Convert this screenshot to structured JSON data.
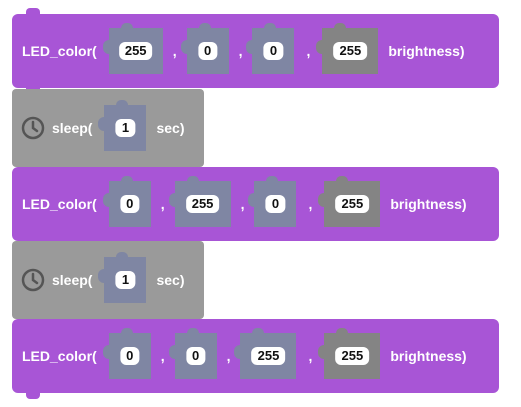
{
  "blocks": [
    {
      "type": "led",
      "label": "LED_color(",
      "values": [
        "255",
        "0",
        "0",
        "255"
      ],
      "sep": ",",
      "tail": "brightness)"
    },
    {
      "type": "sleep",
      "label": "sleep(",
      "value": "1",
      "tail": "sec)",
      "icon": "clock-icon"
    },
    {
      "type": "led",
      "label": "LED_color(",
      "values": [
        "0",
        "255",
        "0",
        "255"
      ],
      "sep": ",",
      "tail": "brightness)"
    },
    {
      "type": "sleep",
      "label": "sleep(",
      "value": "1",
      "tail": "sec)",
      "icon": "clock-icon"
    },
    {
      "type": "led",
      "label": "LED_color(",
      "values": [
        "0",
        "0",
        "255",
        "255"
      ],
      "sep": ",",
      "tail": "brightness)"
    }
  ],
  "colors": {
    "led_block": "#a855d6",
    "sleep_block": "#9a9a9a",
    "socket": "#7f86a3",
    "brightness_socket": "#848484"
  }
}
